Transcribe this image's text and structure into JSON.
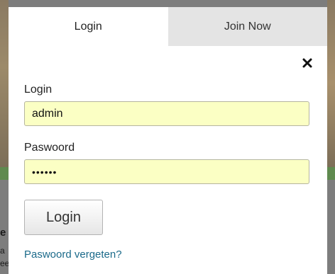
{
  "tabs": [
    {
      "label": "Login",
      "active": true
    },
    {
      "label": "Join Now",
      "active": false
    }
  ],
  "close": {
    "icon": "close-icon"
  },
  "login_field": {
    "label": "Login",
    "value": "admin"
  },
  "password_field": {
    "label": "Paswoord",
    "value": "••••••"
  },
  "submit": {
    "label": "Login"
  },
  "forgot": {
    "label": "Paswoord vergeten?"
  },
  "background": {
    "fragments": [
      "e",
      "a",
      "ee"
    ]
  },
  "colors": {
    "input_background": "#fbffc4",
    "link": "#1b6a8a",
    "inactive_tab": "#e4e4e4"
  }
}
